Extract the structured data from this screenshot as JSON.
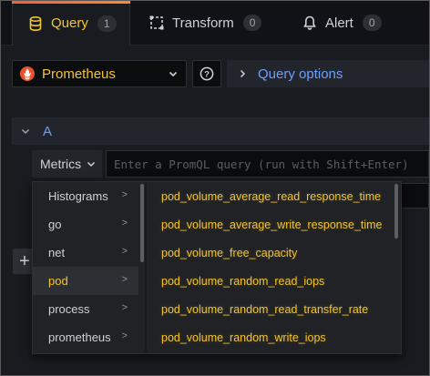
{
  "tabs": [
    {
      "label": "Query",
      "count": "1"
    },
    {
      "label": "Transform",
      "count": "0"
    },
    {
      "label": "Alert",
      "count": "0"
    }
  ],
  "datasource": {
    "name": "Prometheus"
  },
  "toolbar": {
    "help_symbol": "?",
    "query_options_label": "Query options"
  },
  "query": {
    "ref_id": "A",
    "metrics_label": "Metrics",
    "input_placeholder": "Enter a PromQL query (run with Shift+Enter)",
    "add_symbol": "+"
  },
  "cascader": {
    "groups": [
      {
        "label": "Histograms",
        "arrow": ">"
      },
      {
        "label": "go",
        "arrow": ">"
      },
      {
        "label": "net",
        "arrow": ">"
      },
      {
        "label": "pod",
        "arrow": ">"
      },
      {
        "label": "process",
        "arrow": ">"
      },
      {
        "label": "prometheus",
        "arrow": ">"
      }
    ],
    "selected_group": "pod",
    "metrics": [
      "pod_volume_average_read_response_time",
      "pod_volume_average_write_response_time",
      "pod_volume_free_capacity",
      "pod_volume_random_read_iops",
      "pod_volume_random_read_transfer_rate",
      "pod_volume_random_write_iops"
    ]
  },
  "colors": {
    "accent_yellow": "#f4c430",
    "link_blue": "#6e9fff",
    "tab_gradient_start": "#f55f3e",
    "tab_gradient_end": "#ff8833",
    "background": "#111217",
    "panel": "#181b1f"
  },
  "icons": {
    "query_tab": "database-icon",
    "transform_tab": "transform-icon",
    "alert_tab": "bell-icon",
    "datasource": "prometheus-flame-icon",
    "help": "question-circle-icon"
  }
}
